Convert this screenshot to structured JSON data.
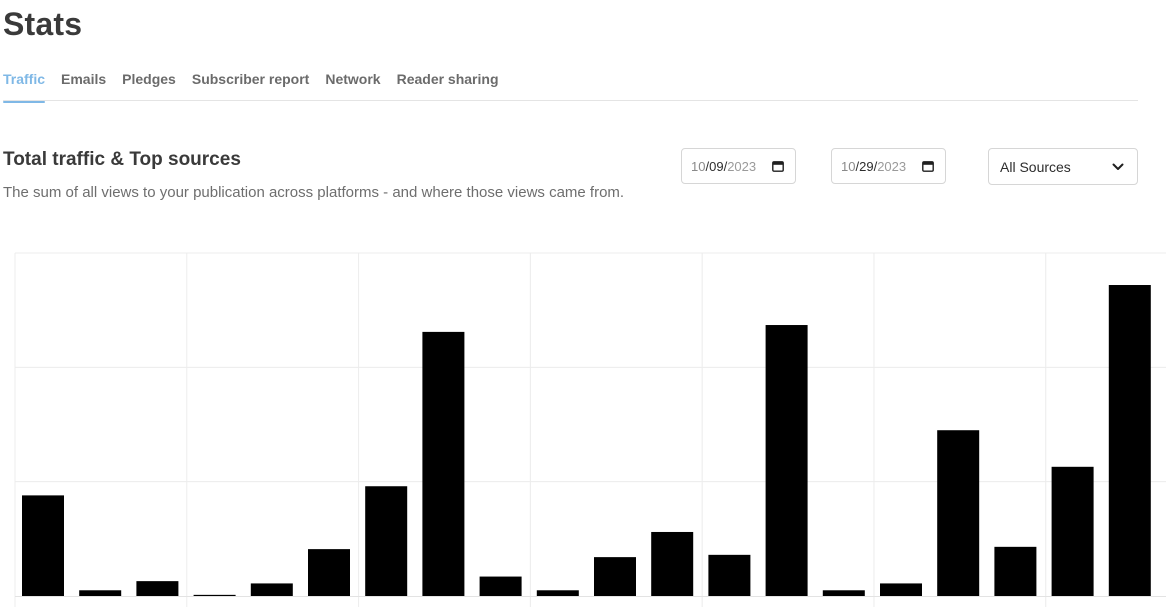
{
  "page": {
    "title": "Stats"
  },
  "tabs": [
    {
      "label": "Traffic",
      "active": true
    },
    {
      "label": "Emails",
      "active": false
    },
    {
      "label": "Pledges",
      "active": false
    },
    {
      "label": "Subscriber report",
      "active": false
    },
    {
      "label": "Network",
      "active": false
    },
    {
      "label": "Reader sharing",
      "active": false
    }
  ],
  "section": {
    "title": "Total traffic & Top sources",
    "description": "The sum of all views to your publication across platforms - and where those views came from."
  },
  "filters": {
    "start_date": {
      "month": "10",
      "day": "09",
      "year": "2023"
    },
    "end_date": {
      "month": "10",
      "day": "29",
      "year": "2023"
    },
    "source": "All Sources"
  },
  "colors": {
    "accent": "#7fb8e6",
    "bar": "#000000",
    "grid": "#ececec"
  },
  "chart_data": {
    "type": "bar",
    "grid": true,
    "ylim": [
      0,
      300
    ],
    "values": [
      88,
      5,
      13,
      1,
      11,
      41,
      96,
      231,
      17,
      5,
      34,
      56,
      36,
      237,
      5,
      11,
      145,
      43,
      113,
      272
    ]
  }
}
